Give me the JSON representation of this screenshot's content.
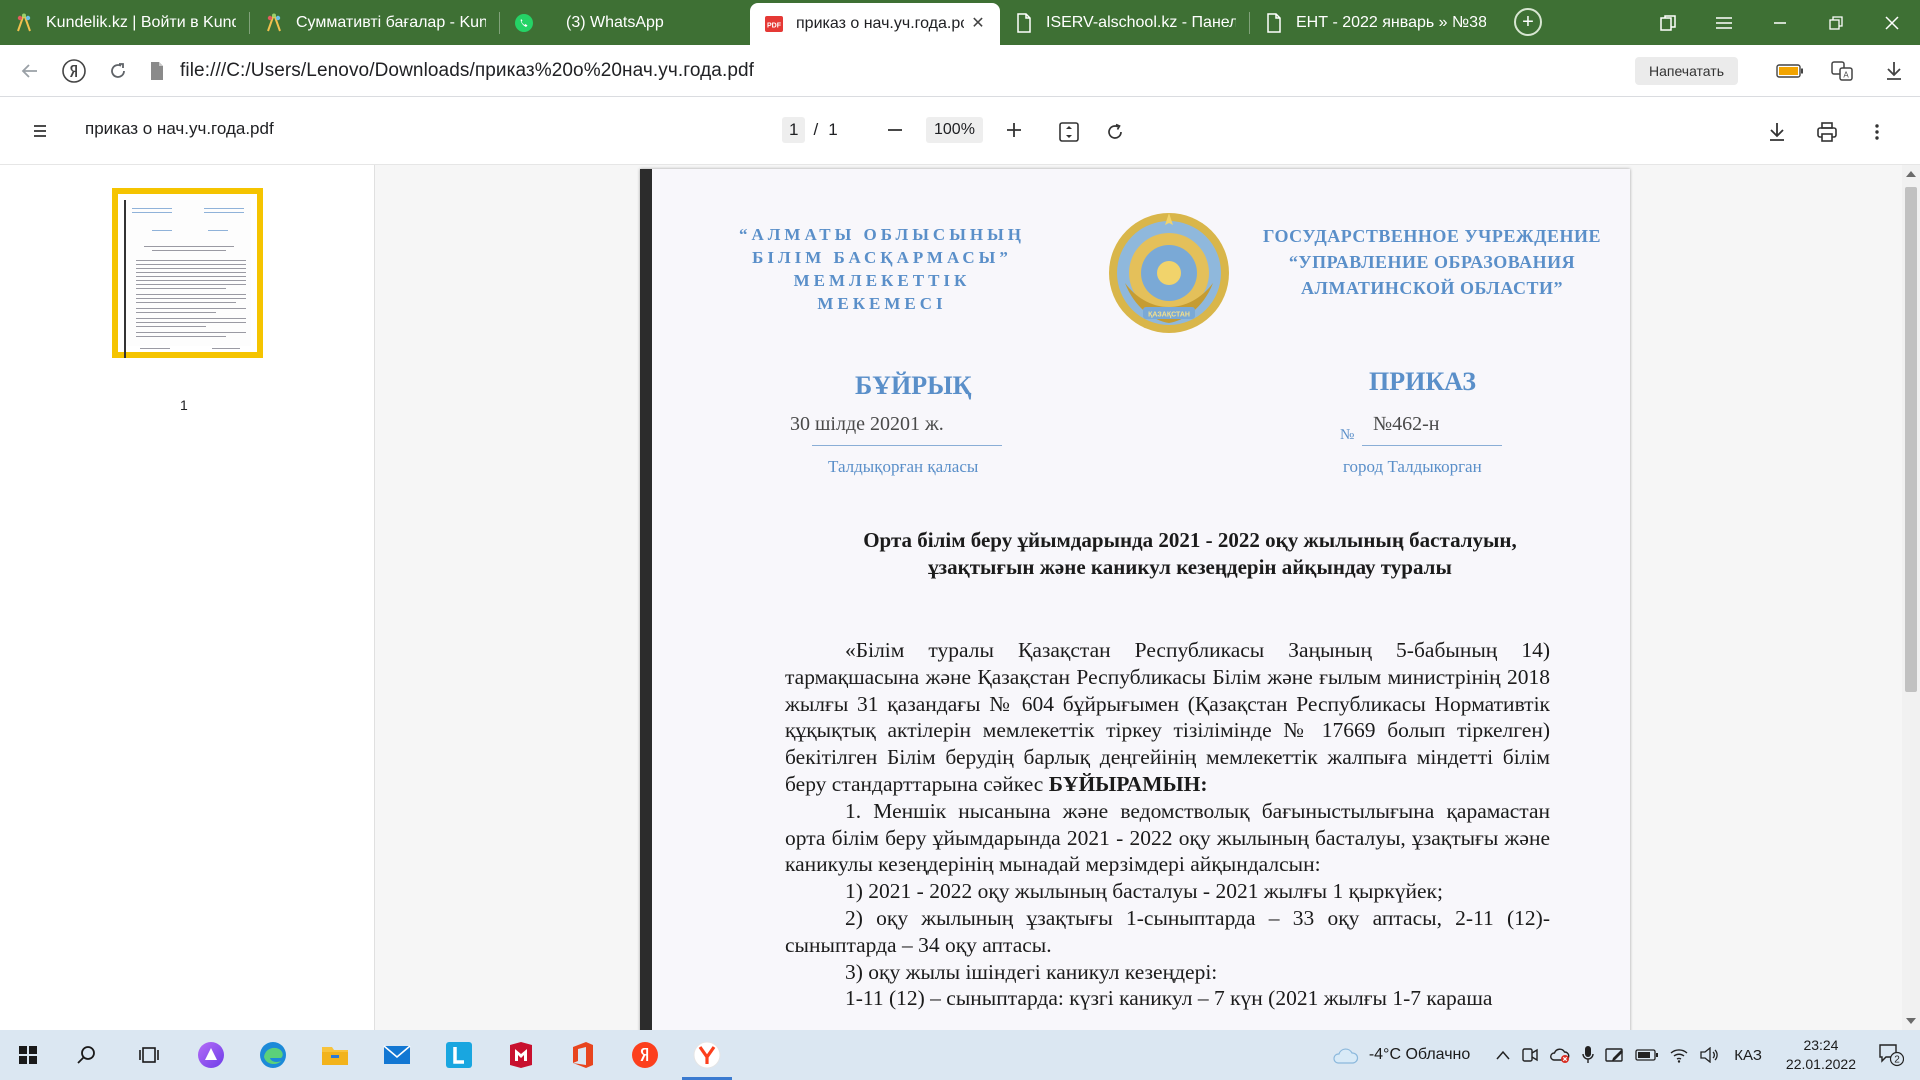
{
  "colors": {
    "tab_bar": "#3e7034",
    "doc_blue": "#5a8fc9",
    "thumb_border": "#f5c400",
    "taskbar": "#dbe7f2"
  },
  "tabs": [
    {
      "title": "Kundelik.kz | Войти в Kund",
      "icon": "kundelik-icon",
      "active": false
    },
    {
      "title": "Суммативті бағалар - Kunc",
      "icon": "kundelik-icon",
      "active": false
    },
    {
      "title": "(3) WhatsApp",
      "icon": "whatsapp-icon",
      "active": false
    },
    {
      "title": "приказ о нач.уч.года.pc",
      "icon": "pdf-icon",
      "active": true
    },
    {
      "title": "ISERV-alschool.kz - Панель",
      "icon": "document-icon",
      "active": false
    },
    {
      "title": "ЕНТ - 2022 январь » №38",
      "icon": "document-icon",
      "active": false
    }
  ],
  "pdf_icon_text": "PDF",
  "address": {
    "url": "file:///C:/Users/Lenovo/Downloads/приказ%20о%20нач.уч.года.pdf",
    "print_label": "Напечатать"
  },
  "pdf_toolbar": {
    "filename": "приказ о нач.уч.года.pdf",
    "current_page": "1",
    "page_sep": "/",
    "total_pages": "1",
    "zoom": "100%"
  },
  "thumbnail": {
    "label": "1"
  },
  "document": {
    "header_kz": [
      "“АЛМАТЫ ОБЛЫСЫНЫҢ",
      "БІЛІМ БАСҚАРМАСЫ”",
      "МЕМЛЕКЕТТІК МЕКЕМЕСІ"
    ],
    "header_ru": [
      "ГОСУДАРСТВЕННОЕ УЧРЕЖДЕНИЕ",
      "“УПРАВЛЕНИЕ ОБРАЗОВАНИЯ",
      "АЛМАТИНСКОЙ ОБЛАСТИ”"
    ],
    "emblem_text": "ҚАЗАҚСТАН",
    "title_kz": "БҰЙРЫҚ",
    "title_ru": "ПРИКАЗ",
    "date_kz": "30 шілде 20201 ж.",
    "city_kz": "Талдықорған қаласы",
    "number_sign": "№",
    "number_ru": "№462-н",
    "city_ru": "город Талдыкорган",
    "doc_title": [
      "Орта білім беру ұйымдарында 2021 - 2022 оқу жылының басталуын,",
      "ұзақтығын және каникул кезеңдерін айқындау туралы"
    ],
    "para1": "«Білім туралы Қазақстан Республикасы Заңының 5-бабының 14) тармақшасына және Қазақстан Республикасы Білім және ғылым министрінің 2018 жылғы 31 қазандағы № 604 бұйрығымен (Қазақстан Республикасы Нормативтік құқықтық актілерін мемлекеттік тіркеу тізілімінде № 17669 болып тіркелген) бекітілген Білім берудің барлық деңгейінің мемлекеттік жалпыға міндетті білім беру стандарттарына сәйкес",
    "para1_bold": "БҰЙЫРАМЫН:",
    "para2": "1. Меншік нысанына және ведомстволық бағыныстылығына қарамастан орта білім беру ұйымдарында 2021 - 2022 оқу жылының басталуы, ұзақтығы және каникулы кезеңдерінің мынадай мерзімдері айқындалсын:",
    "item1": "1) 2021 - 2022 оқу жылының басталуы - 2021 жылғы 1 қыркүйек;",
    "item2": "2) оқу жылының ұзақтығы 1-сыныптарда – 33 оқу аптасы, 2-11 (12)-сыныптарда – 34 оқу аптасы.",
    "item3": "3) оқу жылы ішіндегі каникул кезеңдері:",
    "item4": "1-11 (12) – сыныптарда: күзгі каникул – 7 күн (2021 жылғы 1-7 караша"
  },
  "taskbar": {
    "apps": [
      "start-icon",
      "search-icon",
      "task-view-icon",
      "alice-icon",
      "edge-icon",
      "explorer-icon",
      "mail-icon",
      "lingualeo-icon",
      "mcafee-icon",
      "office-icon",
      "yandex-icon",
      "yandex-browser-icon"
    ],
    "weather": "-4°C Облачно",
    "lang": "КАЗ",
    "time": "23:24",
    "date": "22.01.2022",
    "notifications": "2"
  }
}
